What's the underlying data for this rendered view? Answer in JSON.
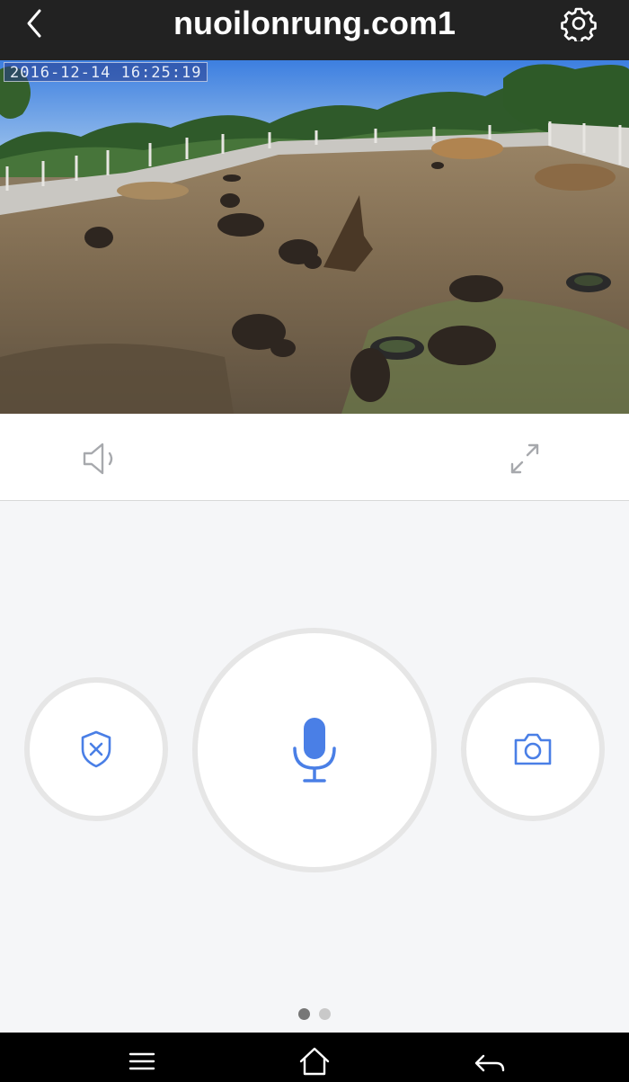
{
  "header": {
    "title": "nuoilonrung.com1",
    "back_icon": "chevron-left-icon",
    "settings_icon": "gear-icon"
  },
  "video": {
    "timestamp": "2016-12-14  16:25:19"
  },
  "controls": {
    "speaker_icon": "speaker-icon",
    "fullscreen_icon": "expand-icon"
  },
  "actions": {
    "privacy_icon": "shield-x-icon",
    "talk_icon": "microphone-icon",
    "snapshot_icon": "camera-icon"
  },
  "pager": {
    "pages": 2,
    "active_page": 1
  },
  "system_nav": {
    "menu_icon": "menu-icon",
    "home_icon": "home-icon",
    "back_icon": "back-arrow-icon"
  },
  "colors": {
    "accent": "#4a7fe6",
    "topbar": "#222222",
    "panel": "#f5f6f8"
  }
}
